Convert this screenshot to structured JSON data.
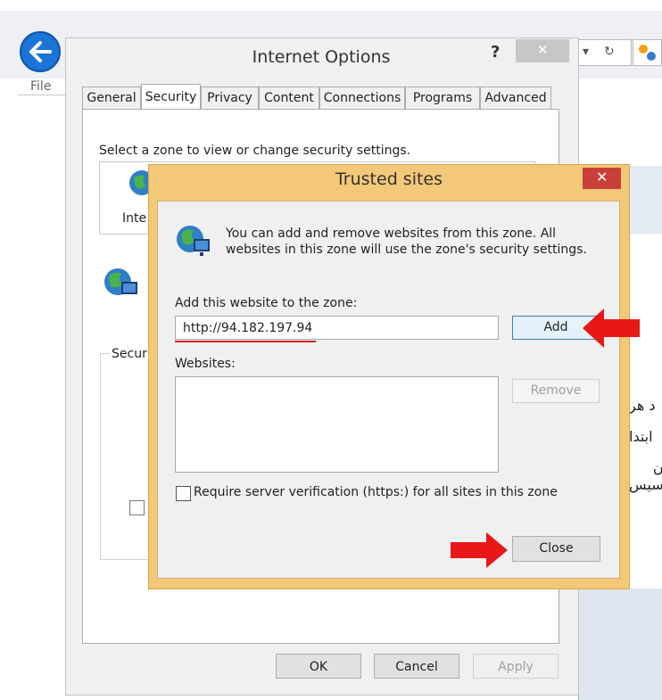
{
  "browser": {
    "menu_file": "File",
    "rtl_line1": "د هر",
    "rtl_line2": "ابتدا",
    "rtl_line3": "ن سیس",
    "accent": "#1b74d6"
  },
  "internet_options": {
    "title": "Internet Options",
    "help": "?",
    "close": "✕",
    "tabs": [
      {
        "label": "General"
      },
      {
        "label": "Security"
      },
      {
        "label": "Privacy"
      },
      {
        "label": "Content"
      },
      {
        "label": "Connections"
      },
      {
        "label": "Programs"
      },
      {
        "label": "Advanced"
      }
    ],
    "active_tab": "Security",
    "zone_label": "Select a zone to view or change security settings.",
    "zone_inte": "Inte",
    "security_group_label": "Securi",
    "buttons": {
      "ok": "OK",
      "cancel": "Cancel",
      "apply": "Apply"
    }
  },
  "trusted_sites": {
    "title": "Trusted sites",
    "close": "✕",
    "description": "You can add and remove websites from this zone. All websites in this zone will use the zone's security settings.",
    "add_label": "Add this website to the zone:",
    "url_value": "http://94.182.197.94",
    "add_button": "Add",
    "websites_label": "Websites:",
    "remove_button": "Remove",
    "verify_label": "Require server verification (https:) for all sites in this zone",
    "close_button": "Close",
    "annotation_color": "#e81818"
  }
}
